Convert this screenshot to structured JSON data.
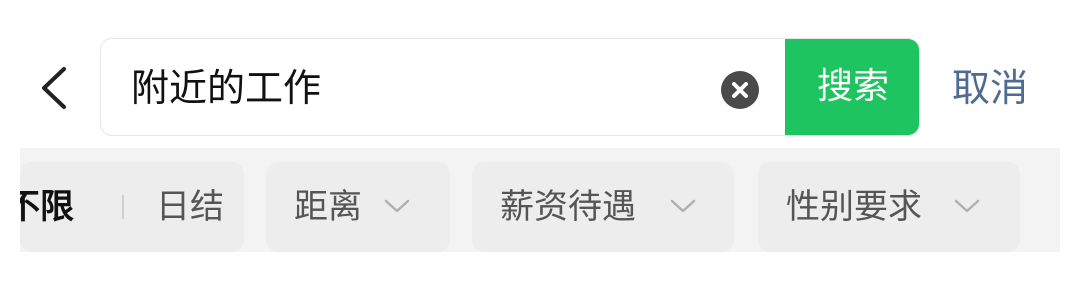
{
  "header": {
    "search_value": "附近的工作",
    "search_button": "搜索",
    "cancel": "取消"
  },
  "filters": {
    "time": {
      "option_selected": "不限",
      "option_other": "日结"
    },
    "distance": "距离",
    "salary": "薪资待遇",
    "gender": "性别要求"
  },
  "colors": {
    "accent_green": "#1ec45f",
    "cancel_link": "#4f6b91",
    "chip_bg": "#ededed"
  },
  "icons": {
    "back": "chevron-left-icon",
    "clear": "clear-icon",
    "dropdown": "chevron-down-icon"
  }
}
